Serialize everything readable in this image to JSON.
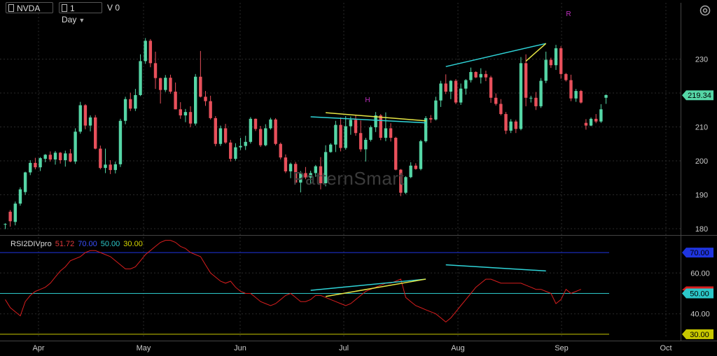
{
  "toolbar": {
    "symbol": "NVDA",
    "period": "1 Day",
    "volume_label": "V 0"
  },
  "watermark": "PatternSmart",
  "colors": {
    "up": "#55d6a6",
    "down": "#e8505b",
    "background": "#000000",
    "grid": "#2a2a2a",
    "rsi_line": "#d81e1e",
    "level_70": "#1f35e0",
    "level_50": "#2cc7c9",
    "level_30": "#c8c800",
    "divergence_cyan": "#2fd4d8",
    "divergence_yellow": "#e6e645",
    "marker_magenta": "#c030c0"
  },
  "chart_data": [
    {
      "type": "candlestick",
      "title": "NVDA",
      "x_labels": [
        "Apr",
        "May",
        "Jun",
        "Jul",
        "Aug",
        "Sep",
        "Oct"
      ],
      "y_ticks": [
        180,
        190,
        200,
        210,
        220,
        230
      ],
      "ylim": [
        178,
        240
      ],
      "last_price": "219.34",
      "grid": true,
      "candles": [
        [
          181.2,
          181.6,
          179.9,
          181.4
        ],
        [
          185,
          185.5,
          180.6,
          182.2
        ],
        [
          182,
          188,
          181,
          187.4
        ],
        [
          187.4,
          192.2,
          186.8,
          191.6
        ],
        [
          190.8,
          196.8,
          190,
          196.6
        ],
        [
          196.6,
          200.2,
          195.8,
          199.4
        ],
        [
          199.4,
          200.9,
          197.5,
          198.1
        ],
        [
          198.1,
          201.1,
          197,
          200.8
        ],
        [
          200.6,
          202,
          199.6,
          201.8
        ],
        [
          201.8,
          202.8,
          199.8,
          200.4
        ],
        [
          200.4,
          202.9,
          198.9,
          202.4
        ],
        [
          202.4,
          202.6,
          199.2,
          200.2
        ],
        [
          200.2,
          203,
          198.3,
          202.2
        ],
        [
          202.2,
          203.5,
          199.6,
          199.8
        ],
        [
          199.8,
          209.6,
          199.1,
          208.6
        ],
        [
          208.6,
          217.4,
          208,
          216.4
        ],
        [
          216.4,
          216.7,
          209.3,
          210.4
        ],
        [
          210.4,
          213.4,
          208.7,
          212.8
        ],
        [
          212.8,
          213.5,
          203.4,
          203.6
        ],
        [
          203.6,
          204.5,
          197.5,
          197.9
        ],
        [
          197.9,
          203.6,
          196.4,
          198.9
        ],
        [
          198.9,
          200.2,
          196.1,
          197.3
        ],
        [
          197.3,
          199.8,
          196.3,
          199
        ],
        [
          199,
          212.4,
          198.2,
          211.8
        ],
        [
          211.8,
          218.9,
          210.8,
          218.2
        ],
        [
          218.2,
          220.1,
          214.7,
          215.4
        ],
        [
          215.4,
          221.2,
          214.7,
          219.4
        ],
        [
          219.4,
          231.4,
          219.1,
          229.4
        ],
        [
          229.4,
          236.2,
          228.6,
          235.4
        ],
        [
          235.4,
          235.9,
          227.6,
          228.8
        ],
        [
          228.8,
          232.2,
          221.2,
          224.4
        ],
        [
          224.4,
          224.5,
          216.9,
          220.9
        ],
        [
          220.9,
          225.3,
          220.3,
          224.5
        ],
        [
          224.5,
          225.4,
          219.8,
          220.4
        ],
        [
          220.4,
          223.1,
          215.2,
          215.2
        ],
        [
          215.2,
          217.3,
          212.4,
          213.4
        ],
        [
          213.4,
          215.3,
          211.4,
          214.4
        ],
        [
          214.4,
          216.1,
          209.9,
          211
        ],
        [
          211,
          225.6,
          210.4,
          224.8
        ],
        [
          224.8,
          232.4,
          218.7,
          218.9
        ],
        [
          218.9,
          220.6,
          216.2,
          217.6
        ],
        [
          217.6,
          219.2,
          212.2,
          212.6
        ],
        [
          212.6,
          213.2,
          204.3,
          205
        ],
        [
          205,
          210.4,
          204.4,
          209.6
        ],
        [
          209.6,
          210.9,
          205,
          205.4
        ],
        [
          205.4,
          206.2,
          199.8,
          200.6
        ],
        [
          200.6,
          205.2,
          200.1,
          204
        ],
        [
          204,
          206.8,
          203.2,
          204.4
        ],
        [
          204.4,
          207.4,
          203.2,
          205.6
        ],
        [
          205.6,
          212.9,
          205.1,
          212.4
        ],
        [
          212.4,
          212.5,
          208.8,
          209.4
        ],
        [
          209.4,
          210.3,
          204.1,
          204.6
        ],
        [
          204.6,
          210.8,
          204.3,
          209.6
        ],
        [
          209.6,
          212.7,
          209.2,
          212.2
        ],
        [
          212.2,
          212.6,
          204.6,
          205
        ],
        [
          205,
          205.4,
          200.4,
          201
        ],
        [
          201,
          201.9,
          196.4,
          196.9
        ],
        [
          196.9,
          199.5,
          194.9,
          199.1
        ],
        [
          199.1,
          199.7,
          193.4,
          193.6
        ],
        [
          193.6,
          197,
          190.7,
          196.4
        ],
        [
          196.4,
          198.2,
          194.6,
          195.1
        ],
        [
          195.1,
          197.1,
          193.1,
          196.4
        ],
        [
          196.4,
          198.8,
          195.3,
          198.4
        ],
        [
          198.4,
          201.1,
          191.6,
          193.4
        ],
        [
          193.4,
          204.6,
          192.5,
          202.6
        ],
        [
          202.6,
          205.2,
          202.4,
          204.8
        ],
        [
          204.8,
          211.8,
          202.6,
          210.6
        ],
        [
          210.6,
          212.8,
          202.8,
          203.8
        ],
        [
          203.8,
          213.2,
          203.3,
          210.2
        ],
        [
          210.2,
          213.1,
          207.7,
          212.1
        ],
        [
          212.1,
          213.6,
          207.4,
          208.2
        ],
        [
          208.2,
          211.9,
          202.7,
          203.4
        ],
        [
          203.4,
          206.8,
          199.8,
          206.2
        ],
        [
          206.2,
          210.4,
          205.7,
          209.9
        ],
        [
          209.9,
          214.4,
          208.5,
          213.4
        ],
        [
          213.4,
          213.8,
          206.1,
          206.8
        ],
        [
          206.8,
          214.3,
          205.8,
          209.6
        ],
        [
          209.6,
          211.1,
          205.7,
          206.8
        ],
        [
          206.8,
          207.1,
          197.2,
          197.4
        ],
        [
          197.4,
          197.6,
          189.6,
          190.6
        ],
        [
          190.6,
          195.5,
          190.2,
          195.2
        ],
        [
          195.2,
          199.6,
          194.9,
          198.6
        ],
        [
          198.6,
          199.3,
          197.4,
          197.6
        ],
        [
          197.6,
          206.2,
          197.2,
          205.8
        ],
        [
          205.8,
          213.2,
          205.4,
          212.6
        ],
        [
          212.6,
          213.5,
          211.2,
          212.2
        ],
        [
          212.2,
          218.9,
          211.9,
          217.8
        ],
        [
          217.8,
          223.6,
          215.9,
          222.8
        ],
        [
          222.8,
          225.5,
          219.7,
          220.4
        ],
        [
          220.4,
          223.8,
          218.2,
          223.6
        ],
        [
          223.6,
          224.1,
          216.7,
          217.2
        ],
        [
          217.2,
          222.8,
          216.5,
          221.3
        ],
        [
          221.3,
          224.1,
          219.5,
          223.8
        ],
        [
          223.8,
          227.5,
          223.1,
          226.2
        ],
        [
          226.2,
          226.4,
          224.4,
          224.6
        ],
        [
          224.6,
          227.3,
          222.8,
          225.6
        ],
        [
          225.6,
          226.6,
          223.5,
          224.6
        ],
        [
          224.6,
          225.1,
          217.1,
          218.6
        ],
        [
          218.6,
          219.9,
          216.3,
          216.8
        ],
        [
          216.8,
          218.2,
          213.4,
          213.8
        ],
        [
          213.8,
          214.4,
          207.9,
          208.9
        ],
        [
          208.9,
          212.3,
          208.2,
          211.6
        ],
        [
          211.6,
          212.1,
          208.2,
          209.4
        ],
        [
          209.4,
          230.6,
          209,
          228.8
        ],
        [
          228.8,
          231.4,
          216.1,
          218.6
        ],
        [
          218.6,
          219.2,
          217.2,
          218.6
        ],
        [
          218.6,
          220.3,
          215,
          216.1
        ],
        [
          216.1,
          224.4,
          215.6,
          223.6
        ],
        [
          223.6,
          232.2,
          222.9,
          229.8
        ],
        [
          229.8,
          230.4,
          227.4,
          228.2
        ],
        [
          228.2,
          234.2,
          226.8,
          233.2
        ],
        [
          233.2,
          233.8,
          224.2,
          225.6
        ],
        [
          225.6,
          225.9,
          223.4,
          223.8
        ],
        [
          223.8,
          225.4,
          217.6,
          218.4
        ],
        [
          218.4,
          221.2,
          217.4,
          220.6
        ],
        [
          220.6,
          220.9,
          216.9,
          217.2
        ],
        [
          211.2,
          212.3,
          209.2,
          210.4
        ],
        [
          210.4,
          212.8,
          210.2,
          212.4
        ],
        [
          212.4,
          213.8,
          211.1,
          211.6
        ],
        [
          211.6,
          216.7,
          211.2,
          215.2
        ],
        [
          218.6,
          219.6,
          216.8,
          219.4
        ]
      ],
      "annotations": [
        {
          "text": "H",
          "color": "magenta"
        },
        {
          "text": "R",
          "color": "magenta"
        }
      ],
      "divergence_lines": [
        {
          "color": "cyan",
          "from": {
            "candle": 61,
            "value": 213.0
          },
          "to": {
            "candle": 84,
            "value": 211.2
          }
        },
        {
          "color": "yellow",
          "from": {
            "candle": 64,
            "value": 214.2
          },
          "to": {
            "candle": 84,
            "value": 211.8
          }
        },
        {
          "color": "cyan",
          "from": {
            "candle": 88,
            "value": 227.8
          },
          "to": {
            "candle": 108,
            "value": 234.6
          }
        },
        {
          "color": "yellow",
          "from": {
            "candle": 104,
            "value": 229.4
          },
          "to": {
            "candle": 108,
            "value": 234.6
          }
        }
      ]
    },
    {
      "type": "line",
      "title": "RSI2DIVpro",
      "legend_values": [
        "51.72",
        "70.00",
        "50.00",
        "30.00"
      ],
      "levels": [
        70,
        50,
        30
      ],
      "y_ticks": [
        40,
        60
      ],
      "ylim": [
        27,
        82
      ],
      "current_value": "51.72",
      "values": [
        47,
        43,
        41,
        39,
        46,
        49,
        51,
        52,
        53,
        55,
        58,
        61,
        63,
        66,
        67,
        68,
        70,
        71,
        71,
        70,
        69,
        68,
        66,
        64,
        62,
        62,
        63,
        66,
        69,
        71,
        73,
        75,
        76,
        76,
        75,
        73,
        72,
        70,
        69,
        68,
        64,
        60,
        58,
        56,
        55,
        56,
        53,
        51,
        50,
        50,
        48,
        46,
        45,
        44,
        45,
        47,
        49,
        50,
        48,
        46,
        46,
        47,
        49,
        49,
        48,
        47,
        46,
        45,
        44,
        45,
        47,
        49,
        51,
        52,
        53,
        54,
        55,
        55,
        56,
        57,
        48,
        46,
        44,
        43,
        42,
        41,
        40,
        38,
        36,
        38,
        41,
        44,
        47,
        50,
        53,
        55,
        57,
        57,
        56,
        55,
        55,
        55,
        55,
        55,
        54,
        53,
        52,
        52,
        51,
        50,
        45,
        47,
        52,
        50,
        51,
        52
      ],
      "divergence_lines": [
        {
          "color": "cyan",
          "from": {
            "candle": 61,
            "value": 51.5
          },
          "to": {
            "candle": 84,
            "value": 57
          }
        },
        {
          "color": "yellow",
          "from": {
            "candle": 64,
            "value": 48.5
          },
          "to": {
            "candle": 84,
            "value": 57
          }
        },
        {
          "color": "cyan",
          "from": {
            "candle": 88,
            "value": 64
          },
          "to": {
            "candle": 108,
            "value": 61
          }
        }
      ]
    }
  ]
}
